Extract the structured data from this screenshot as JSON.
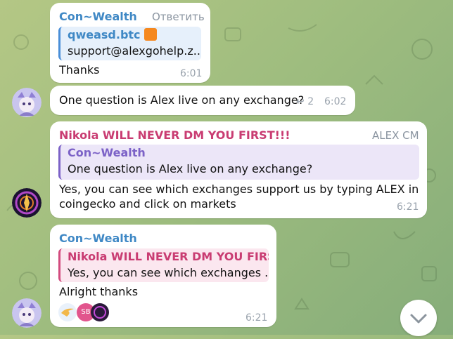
{
  "messages": [
    {
      "sender": "Con~Wealth",
      "side_action": "Ответить",
      "quote_title": "qweasd.btc",
      "quote_text": "support@alexgohelp.z...",
      "text": "Thanks",
      "time": "6:01"
    },
    {
      "text": "One question is Alex live on any exchange?",
      "replies_count": "2",
      "time": "6:02"
    },
    {
      "sender": "Nikola WILL NEVER DM YOU FIRST!!!",
      "side_tag": "ALEX CM",
      "quote_title": "Con~Wealth",
      "quote_text": "One question is Alex live on any exchange?",
      "text_line1": "Yes, you can see which exchanges support us by typing ALEX in",
      "text_line2": "coingecko and click on markets",
      "time": "6:21"
    },
    {
      "sender": "Con~Wealth",
      "quote_title": "Nikola WILL NEVER DM YOU FIRST!!!",
      "quote_text": "Yes, you can see which exchanges ...",
      "text": "Alright thanks",
      "reaction_initials": "SB",
      "time": "6:21"
    }
  ],
  "colors": {
    "accent_blue": "#3f88c5",
    "accent_pink": "#c93c72",
    "bubble": "#ffffff"
  },
  "icons": [
    "orange-square-emoji",
    "reply-arrow-icon",
    "chevron-down-icon",
    "pointing-hand-emoji"
  ]
}
